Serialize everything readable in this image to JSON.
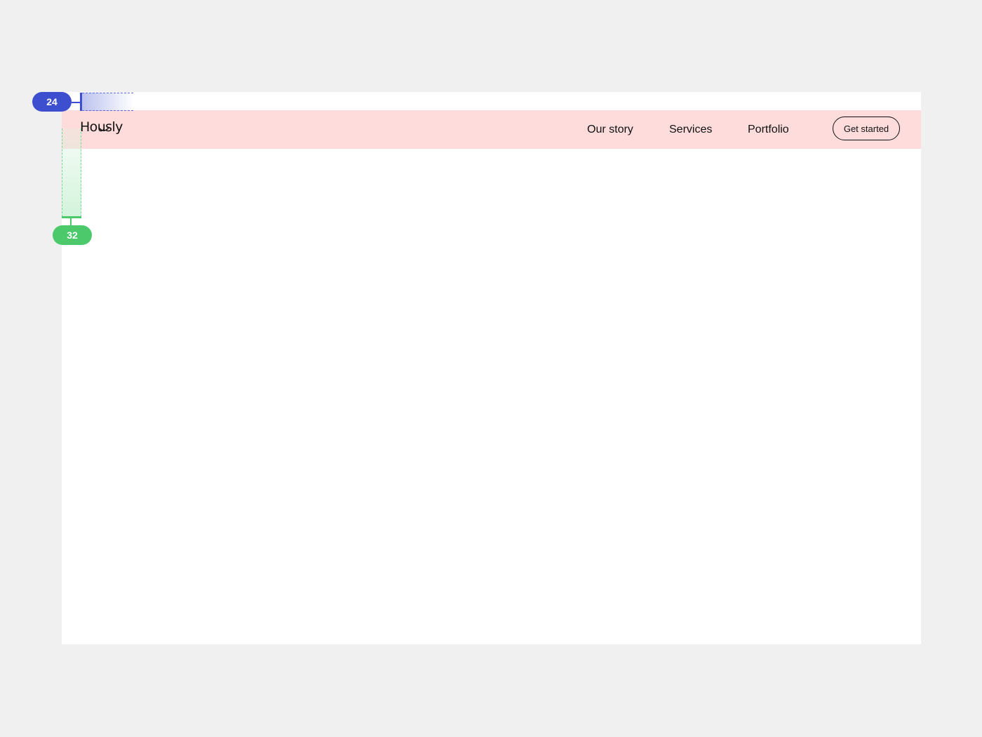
{
  "brand": {
    "logo_text": "Hously"
  },
  "nav": {
    "links": [
      {
        "label": "Our story"
      },
      {
        "label": "Services"
      },
      {
        "label": "Portfolio"
      }
    ],
    "cta_label": "Get started"
  },
  "annotations": {
    "horizontal_padding": "24",
    "vertical_spacing": "32"
  },
  "colors": {
    "background": "#f0f0f0",
    "frame": "#ffffff",
    "navbar": "#fddcdb",
    "annotation_blue": "#3d4fcf",
    "annotation_green": "#4cc96a"
  }
}
